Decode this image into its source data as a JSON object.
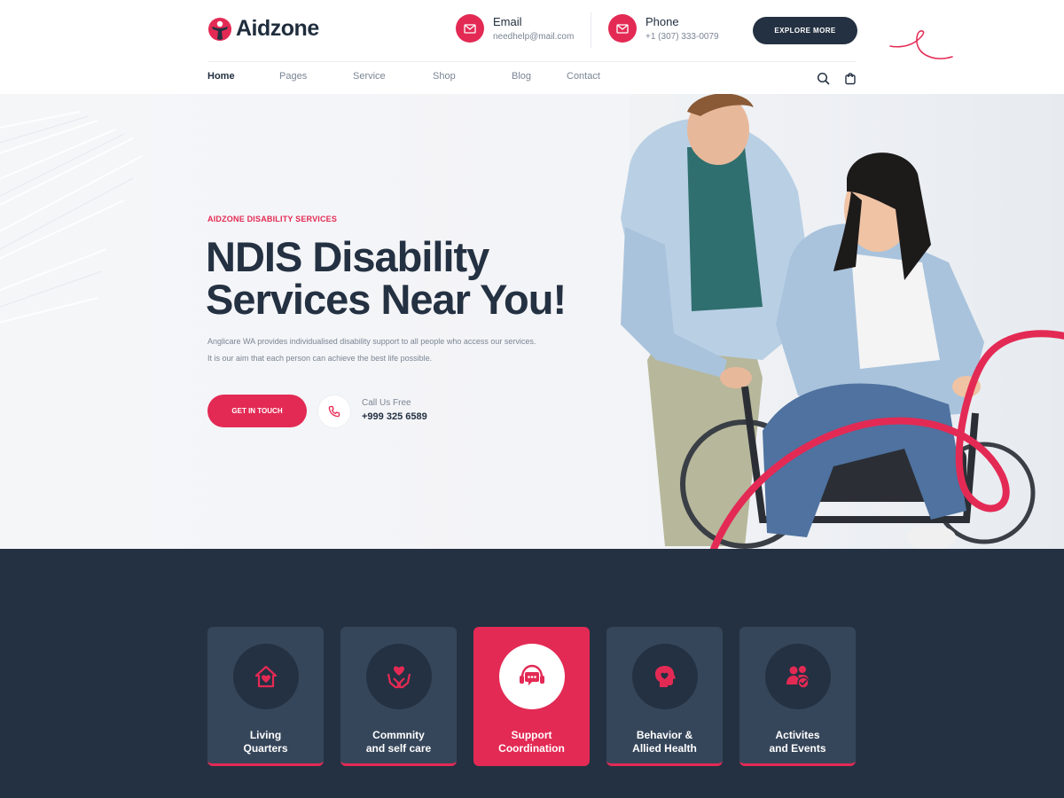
{
  "brand": {
    "name": "Aidzone",
    "accent": "#e32a54",
    "dark": "#243142"
  },
  "header": {
    "email": {
      "title": "Email",
      "value": "needhelp@mail.com",
      "icon": "envelope-icon"
    },
    "phone": {
      "title": "Phone",
      "value": "+1 (307) 333-0079",
      "icon": "envelope-icon"
    },
    "cta_label": "EXPLORE MORE"
  },
  "nav": {
    "items": [
      {
        "label": "Home",
        "active": true
      },
      {
        "label": "Pages"
      },
      {
        "label": "Service"
      },
      {
        "label": "Shop"
      },
      {
        "label": "Blog"
      },
      {
        "label": "Contact"
      }
    ],
    "icons": [
      "search-icon",
      "shopping-bag-icon"
    ]
  },
  "hero": {
    "kicker": "AIDZONE DISABILITY SERVICES",
    "title_line1": "NDIS Disability",
    "title_line2": "Services Near You!",
    "desc_line1": "Anglicare WA provides individualised disability support to all people who access our services.",
    "desc_line2": "It is our aim that each person can achieve the best life possible.",
    "cta_label": "GET IN TOUCH",
    "call_label": "Call Us Free",
    "call_number": "+999 325 6589"
  },
  "services": [
    {
      "line1": "Living",
      "line2": "Quarters",
      "icon": "home-heart-icon"
    },
    {
      "line1": "Commnity",
      "line2": "and self care",
      "icon": "hands-heart-icon"
    },
    {
      "line1": "Support",
      "line2": "Coordination",
      "icon": "headset-chat-icon",
      "active": true
    },
    {
      "line1": "Behavior &",
      "line2": "Allied Health",
      "icon": "head-heart-icon"
    },
    {
      "line1": "Activites",
      "line2": "and Events",
      "icon": "people-check-icon"
    }
  ]
}
